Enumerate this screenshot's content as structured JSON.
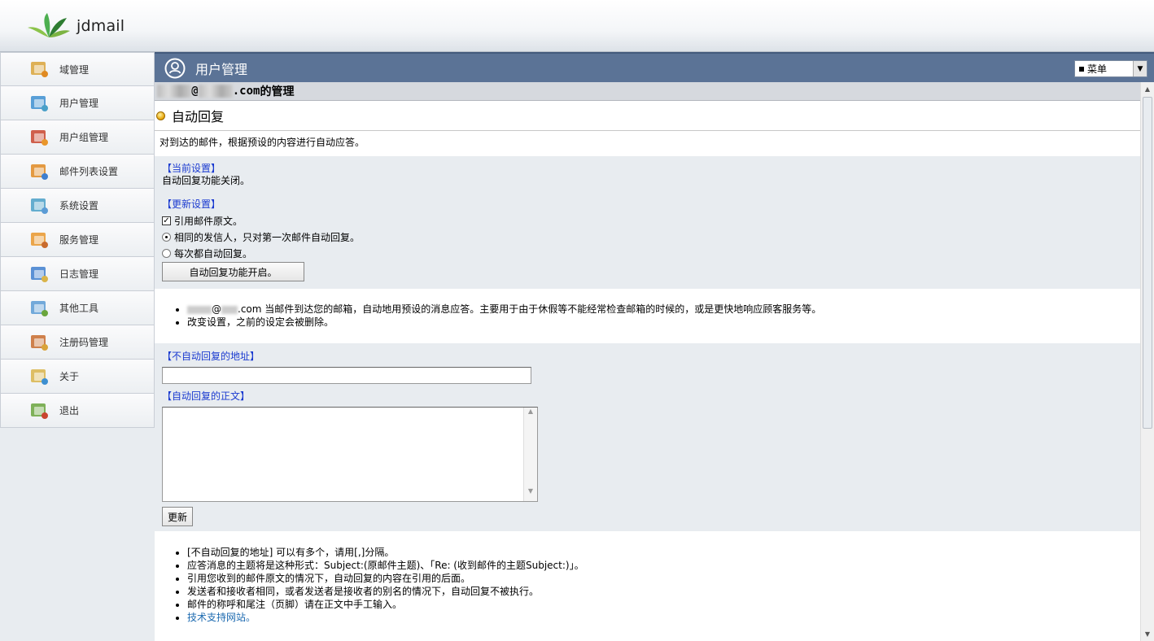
{
  "app": {
    "name": "jdmail"
  },
  "sidebar": {
    "items": [
      {
        "label": "域管理",
        "icon": "domain-icon"
      },
      {
        "label": "用户管理",
        "icon": "user-icon"
      },
      {
        "label": "用户组管理",
        "icon": "user-group-icon"
      },
      {
        "label": "邮件列表设置",
        "icon": "mailing-list-icon"
      },
      {
        "label": "系统设置",
        "icon": "system-settings-icon"
      },
      {
        "label": "服务管理",
        "icon": "service-icon"
      },
      {
        "label": "日志管理",
        "icon": "log-icon"
      },
      {
        "label": "其他工具",
        "icon": "tools-icon"
      },
      {
        "label": "注册码管理",
        "icon": "license-icon"
      },
      {
        "label": "关于",
        "icon": "about-icon"
      },
      {
        "label": "退出",
        "icon": "logout-icon"
      }
    ]
  },
  "header": {
    "title": "用户管理",
    "menu_value": "菜单"
  },
  "account": {
    "domain_suffix": ".com",
    "manage_suffix": " 的管理"
  },
  "autoreply": {
    "title": "自动回复",
    "description": "对到达的邮件，根据预设的内容进行自动应答。",
    "current_label": "【当前设置】",
    "current_value": "自动回复功能关闭。",
    "update_label": "【更新设置】",
    "quote_label": "引用邮件原文。",
    "quote_checked": true,
    "option_once": "相同的发信人，只对第一次邮件自动回复。",
    "option_every": "每次都自动回复。",
    "selected_option": "once",
    "enable_button": "自动回复功能开启。"
  },
  "notes1": {
    "item1_suffix": ".com 当邮件到达您的邮箱，自动地用预设的消息应答。主要用于由于休假等不能经常检查邮箱的时候的，或是更快地响应顾客服务等。",
    "item2": "改变设置，之前的设定会被删除。"
  },
  "form": {
    "exclude_label": "【不自动回复的地址】",
    "exclude_value": "",
    "body_label": "【自动回复的正文】",
    "body_value": "",
    "submit_button": "更新"
  },
  "notes2": {
    "items": [
      "[不自动回复的地址] 可以有多个，请用[,]分隔。",
      "应答消息的主题将是这种形式：Subject:(原邮件主题)、「Re: (收到邮件的主题Subject:)」。",
      "引用您收到的邮件原文的情况下，自动回复的内容在引用的后面。",
      "发送者和接收者相同，或者发送者是接收者的别名的情况下，自动回复不被执行。",
      "邮件的称呼和尾注（页脚）请在正文中手工输入。"
    ],
    "link": "技术支持网站。"
  },
  "colors": {
    "titlebar": "#5b7396",
    "panel": "#e8ecf0",
    "label_blue": "#1a3ad0",
    "link": "#1c6ab0"
  }
}
